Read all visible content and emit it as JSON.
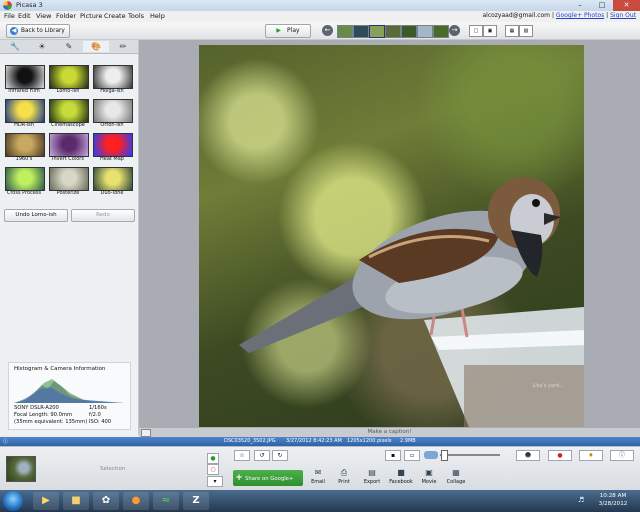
{
  "window": {
    "title": "Picasa 3"
  },
  "menu": {
    "items": [
      "File",
      "Edit",
      "View",
      "Folder",
      "Picture",
      "Create",
      "Tools",
      "Help"
    ],
    "account": "alcozyaad@gmail.com",
    "separator": "|",
    "google_photos": "Google+ Photos",
    "sign_out": "Sign Out"
  },
  "toolbar": {
    "back_label": "Back to Library",
    "play_label": "Play"
  },
  "effects": [
    {
      "label": "Infrared Film",
      "colors": [
        "#111",
        "#ddd"
      ]
    },
    {
      "label": "Lomo-ish",
      "colors": [
        "#c9d935",
        "#1f2a10"
      ]
    },
    {
      "label": "Holga-ish",
      "colors": [
        "#eee",
        "#333"
      ]
    },
    {
      "label": "HDR-ish",
      "colors": [
        "#f6e04a",
        "#1b3a8a"
      ]
    },
    {
      "label": "Cinemascope",
      "colors": [
        "#c7dc3a",
        "#203010"
      ]
    },
    {
      "label": "Orton-ish",
      "colors": [
        "#e8e8e8",
        "#777"
      ]
    },
    {
      "label": "1960's",
      "colors": [
        "#c9a860",
        "#4a3a22"
      ]
    },
    {
      "label": "Invert Colors",
      "colors": [
        "#5a2a6a",
        "#c7a8e0"
      ]
    },
    {
      "label": "Heat Map",
      "colors": [
        "#ff2020",
        "#2040ff"
      ]
    },
    {
      "label": "Cross Process",
      "colors": [
        "#c0f060",
        "#2a5a4a"
      ]
    },
    {
      "label": "Posterize",
      "colors": [
        "#d8d8c8",
        "#6a6a58"
      ]
    },
    {
      "label": "Duo-Tone",
      "colors": [
        "#e8e070",
        "#2a4a3a"
      ]
    }
  ],
  "undo_label": "Undo Lomo-ish",
  "redo_label": "Redo",
  "histogram": {
    "title": "Histogram & Camera Information",
    "camera_model": "SONY DSLR-A200",
    "shutter": "1/160s",
    "focal_length": "Focal Length: 90.0mm",
    "aperture": "f/2.0",
    "equivalent": "(35mm equivalent: 135mm)",
    "iso": "ISO: 400"
  },
  "caption_placeholder": "Make a caption!",
  "status": {
    "filename": "DSC03520_3502.JPG",
    "datetime": "3/27/2012 8:42:23 AM",
    "dimensions": "1205x1200 pixels",
    "filesize": "2.9MB"
  },
  "tray": {
    "selection_label": "Selection"
  },
  "share_label": "Share on Google+",
  "actions": [
    "Email",
    "Print",
    "Export",
    "Facebook",
    "Movie",
    "Collage"
  ],
  "watermark": "Lisa's yard...",
  "clock": {
    "time": "10:28 AM",
    "date": "3/28/2012"
  }
}
